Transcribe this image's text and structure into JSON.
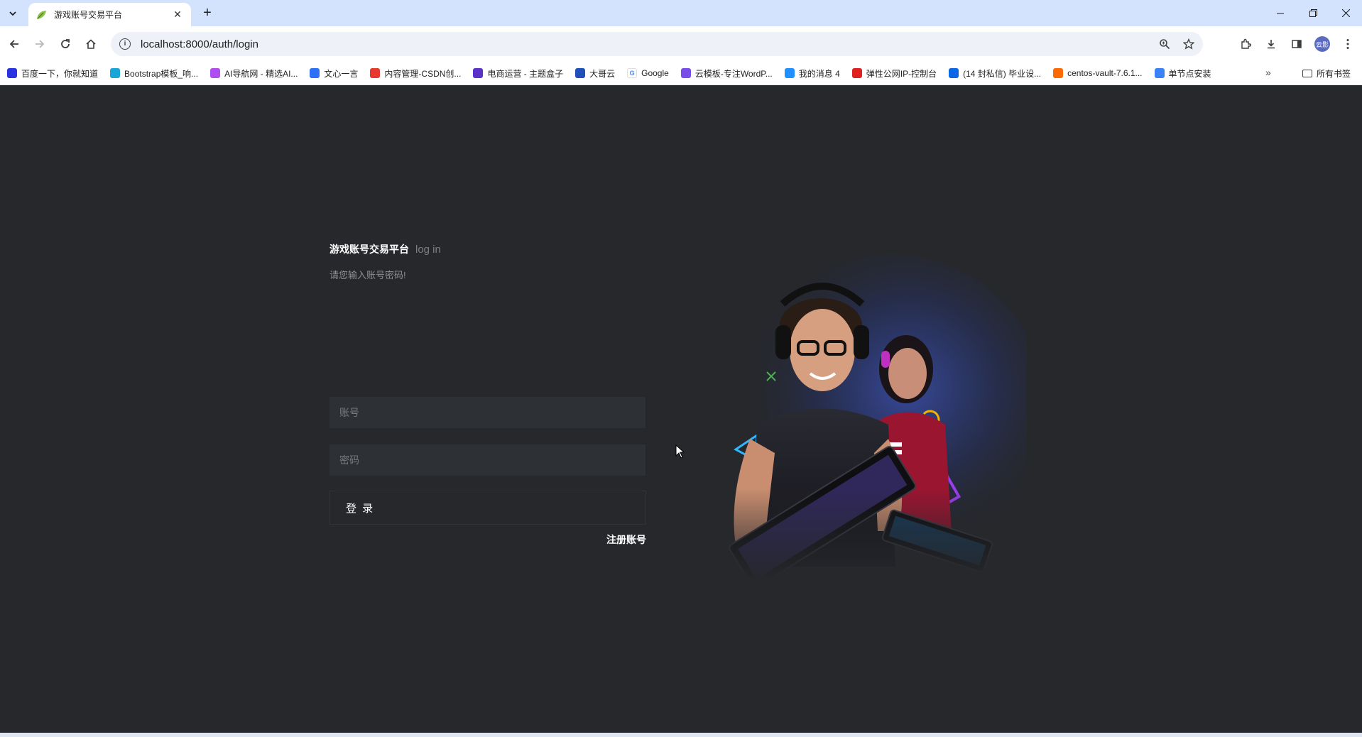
{
  "browser": {
    "tab": {
      "title": "游戏账号交易平台"
    },
    "url": "localhost:8000/auth/login",
    "profile_initials": "云影",
    "bookmarks": [
      {
        "label": "百度一下，你就知道",
        "color": "#2932e1",
        "icon": "baidu-icon"
      },
      {
        "label": "Bootstrap模板_响...",
        "color": "#1aa5d8",
        "icon": "bootstrap-icon"
      },
      {
        "label": "AI导航网 - 精选AI...",
        "color": "#b04df0",
        "icon": "ai-nav-icon"
      },
      {
        "label": "文心一言",
        "color": "#2d6ff7",
        "icon": "wenxin-icon"
      },
      {
        "label": "内容管理-CSDN创...",
        "color": "#e63a2e",
        "icon": "csdn-icon"
      },
      {
        "label": "电商运营 - 主题盒子",
        "color": "#5a32c8",
        "icon": "theme-box-icon"
      },
      {
        "label": "大哥云",
        "color": "#1f4fb8",
        "icon": "dagecloud-icon"
      },
      {
        "label": "Google",
        "color": "#ffffff",
        "icon": "google-icon"
      },
      {
        "label": "云模板-专注WordP...",
        "color": "#7a4de8",
        "icon": "yunmoban-icon"
      },
      {
        "label": "我的消息 4",
        "color": "#1e90ff",
        "icon": "bilibili-icon"
      },
      {
        "label": "弹性公网IP-控制台",
        "color": "#e02020",
        "icon": "huawei-icon"
      },
      {
        "label": "(14 封私信) 毕业设...",
        "color": "#0a66e4",
        "icon": "zhihu-icon"
      },
      {
        "label": "centos-vault-7.6.1...",
        "color": "#ff6a00",
        "icon": "aliyun-icon"
      },
      {
        "label": "单节点安装",
        "color": "#3b82f6",
        "icon": "layers-icon"
      }
    ],
    "all_bookmarks": "所有书签"
  },
  "login": {
    "brand": "游戏账号交易平台",
    "brand_sub": "log in",
    "hint": "请您输入账号密码!",
    "account_placeholder": "账号",
    "password_placeholder": "密码",
    "login_button": "登 录",
    "register_link": "注册账号"
  },
  "colors": {
    "page_bg": "#26282c",
    "field_bg": "#2d3034",
    "tab_strip": "#d3e3fd"
  }
}
